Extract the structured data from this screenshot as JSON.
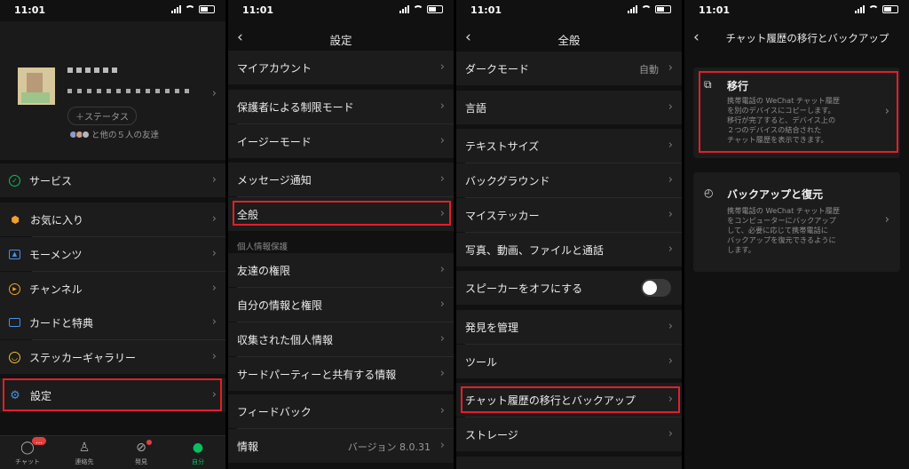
{
  "status_time": "11:01",
  "panel1": {
    "add_status": "＋ステータス",
    "friends_text": "と他の５人の友達",
    "menu": [
      {
        "label": "サービス",
        "icon": "service-icon"
      },
      {
        "label": "お気に入り",
        "icon": "favorites-icon"
      },
      {
        "label": "モーメンツ",
        "icon": "moments-icon"
      },
      {
        "label": "チャンネル",
        "icon": "channels-icon"
      },
      {
        "label": "カードと特典",
        "icon": "cards-icon"
      },
      {
        "label": "ステッカーギャラリー",
        "icon": "sticker-icon"
      }
    ],
    "settings": "設定",
    "tabs": [
      {
        "label": "チャット",
        "badge": "…"
      },
      {
        "label": "連絡先"
      },
      {
        "label": "発見"
      },
      {
        "label": "自分"
      }
    ]
  },
  "panel2": {
    "title": "設定",
    "rows": {
      "account": "マイアカウント",
      "parental": "保護者による制限モード",
      "easy": "イージーモード",
      "notifications": "メッセージ通知",
      "general": "全般",
      "privacy_section": "個人情報保護",
      "friends": "友達の権限",
      "my_info": "自分の情報と権限",
      "collected": "収集された個人情報",
      "third_party": "サードパーティーと共有する情報",
      "feedback": "フィードバック",
      "about": "情報",
      "version": "バージョン 8.0.31"
    }
  },
  "panel3": {
    "title": "全般",
    "rows": {
      "dark_mode": "ダークモード",
      "dark_mode_value": "自動",
      "language": "言語",
      "text_size": "テキストサイズ",
      "background": "バックグラウンド",
      "my_stickers": "マイステッカー",
      "media": "写真、動画、ファイルと通話",
      "speaker_off": "スピーカーをオフにする",
      "discover": "発見を管理",
      "tools": "ツール",
      "migrate_backup": "チャット履歴の移行とバックアップ",
      "storage": "ストレージ"
    }
  },
  "panel4": {
    "title": "チャット履歴の移行とバックアップ",
    "migrate_title": "移行",
    "migrate_desc": [
      "携帯電話の WeChat チャット履歴",
      "を別のデバイスにコピーします。",
      "移行が完了すると、デバイス上の",
      "２つのデバイスの結合された",
      "チャット履歴を表示できます。"
    ],
    "backup_title": "バックアップと復元",
    "backup_desc": [
      "携帯電話の WeChat チャット履歴",
      "をコンピューターにバックアップ",
      "して、必要に応じて携帯電話に",
      "バックアップを復元できるように",
      "します。"
    ]
  },
  "colors": {
    "highlight": "#e0202a",
    "accent_green": "#07c160",
    "background": "#111111",
    "row": "#1c1c1c"
  }
}
